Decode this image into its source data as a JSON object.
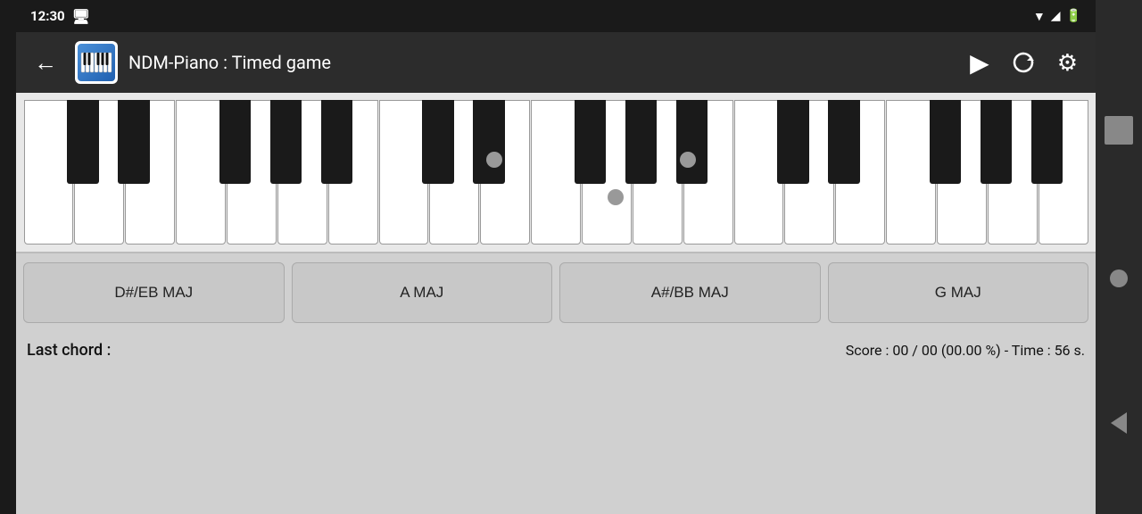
{
  "status_bar": {
    "time": "12:30",
    "sim_icon": "📶"
  },
  "app_bar": {
    "title": "NDM-Piano : Timed game",
    "back_label": "←",
    "play_label": "▶",
    "refresh_label": "↻",
    "settings_label": "⚙"
  },
  "chord_buttons": [
    {
      "label": "D#/EB MAJ"
    },
    {
      "label": "A MAJ"
    },
    {
      "label": "A#/BB MAJ"
    },
    {
      "label": "G MAJ"
    }
  ],
  "game_status": {
    "last_chord_label": "Last chord :",
    "score_text": "Score :  00 / 00 (00.00 %)  - Time :  56  s."
  },
  "piano": {
    "dot1_label": "note-dot-1",
    "dot2_label": "note-dot-2",
    "dot3_label": "note-dot-3"
  }
}
